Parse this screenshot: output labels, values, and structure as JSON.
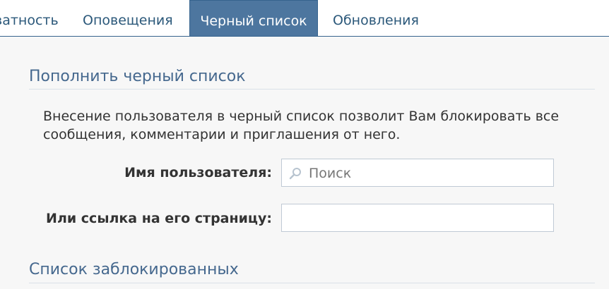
{
  "tabs": [
    {
      "label": "ватность",
      "active": false
    },
    {
      "label": "Оповещения",
      "active": false
    },
    {
      "label": "Черный список",
      "active": true
    },
    {
      "label": "Обновления",
      "active": false
    }
  ],
  "add_section": {
    "title": "Пополнить черный список",
    "description": "Внесение пользователя в черный список позволит Вам блокировать все сообщения, комментарии и приглашения от него.",
    "username_label": "Имя пользователя:",
    "username_placeholder": "Поиск",
    "link_label": "Или ссылка на его страницу:",
    "link_value": ""
  },
  "blocked_section": {
    "title": "Список заблокированных"
  },
  "colors": {
    "accent": "#4d769f",
    "title": "#45688e",
    "link": "#2b587a",
    "panel_bg": "#f7f7f7"
  },
  "icons": {
    "search": "search-icon"
  }
}
